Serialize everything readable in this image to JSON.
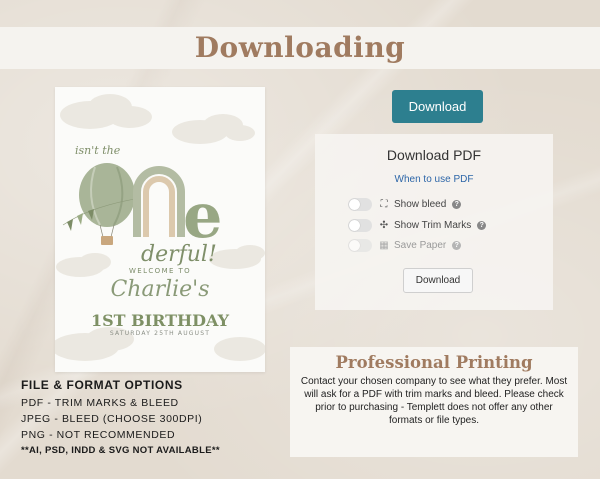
{
  "header": {
    "title": "Downloading"
  },
  "invitation": {
    "top_text": "isn't the",
    "one": "one",
    "derful": "derful!",
    "welcome": "WELCOME TO",
    "name": "Charlie's",
    "birthday": "1ST BIRTHDAY",
    "date": "SATURDAY 25TH AUGUST"
  },
  "download_button": {
    "label": "Download"
  },
  "panel": {
    "title": "Download PDF",
    "link": "When to use PDF",
    "options": [
      {
        "label": "Show bleed",
        "icon": "expand-icon",
        "enabled": true
      },
      {
        "label": "Show Trim Marks",
        "icon": "trim-marks-icon",
        "enabled": true
      },
      {
        "label": "Save Paper",
        "icon": "grid-icon",
        "enabled": false
      }
    ],
    "button_label": "Download"
  },
  "printing": {
    "title": "Professional Printing",
    "body": "Contact your chosen company to see what they prefer. Most will ask for a PDF with trim marks and bleed. Please check prior to purchasing - Templett does not offer any other formats or file types."
  },
  "file_options": {
    "heading": "FILE & FORMAT OPTIONS",
    "lines": [
      "PDF - TRIM MARKS & BLEED",
      "JPEG - BLEED (CHOOSE 300DPI)",
      "PNG - NOT RECOMMENDED"
    ],
    "note": "**AI, PSD, INDD & SVG NOT AVAILABLE**"
  },
  "colors": {
    "accent": "#a07b60",
    "button": "#2d7f8f",
    "link": "#2d66a8",
    "sage": "#8a9a78"
  }
}
